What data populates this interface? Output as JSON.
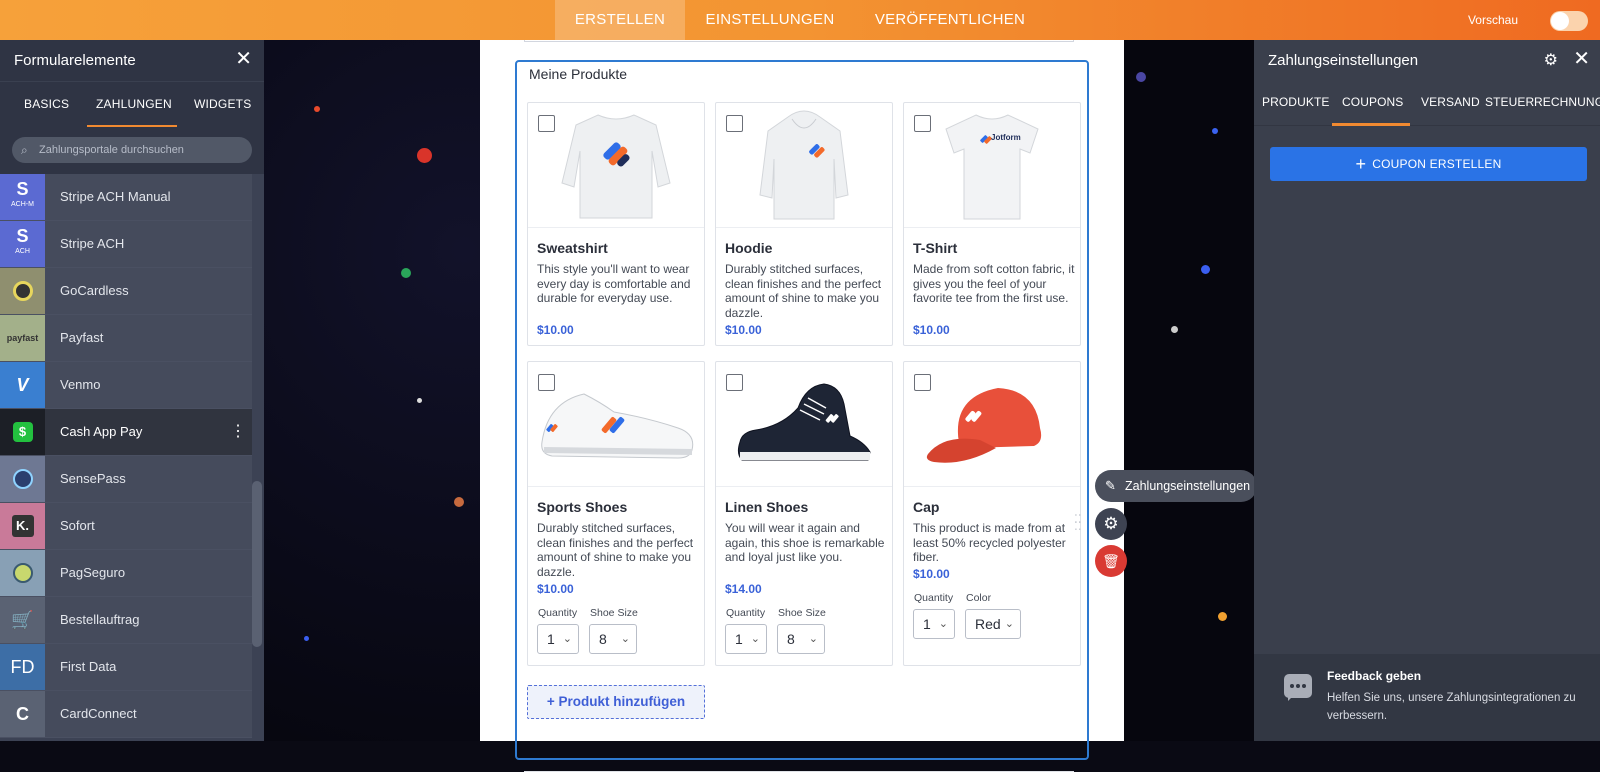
{
  "topbar": {
    "tabs": [
      "ERSTELLEN",
      "EINSTELLUNGEN",
      "VERÖFFENTLICHEN"
    ],
    "preview_label": "Vorschau"
  },
  "left_panel": {
    "title": "Formularelemente",
    "tabs": [
      "BASICS",
      "ZAHLUNGEN",
      "WIDGETS"
    ],
    "active_tab": "ZAHLUNGEN",
    "search_placeholder": "Zahlungsportale durchsuchen",
    "items": [
      {
        "name": "Stripe ACH Manual",
        "icon": "S",
        "sub": "ACH-M",
        "color": "#5b6ad2"
      },
      {
        "name": "Stripe ACH",
        "icon": "S",
        "sub": "ACH",
        "color": "#5b6ad2"
      },
      {
        "name": "GoCardless",
        "icon": "gocardless-icon",
        "color": "#8f8f6f"
      },
      {
        "name": "Payfast",
        "icon": "payfast",
        "color": "#a3b08a"
      },
      {
        "name": "Venmo",
        "icon": "V",
        "color": "#3a7fd0"
      },
      {
        "name": "Cash App Pay",
        "icon": "$",
        "color": "#1c1f26"
      },
      {
        "name": "SensePass",
        "icon": "sensepass-icon",
        "color": "#6e7893"
      },
      {
        "name": "Sofort",
        "icon": "K.",
        "color": "#c97a99"
      },
      {
        "name": "PagSeguro",
        "icon": "pagseguro-icon",
        "color": "#88a0b5"
      },
      {
        "name": "Bestellauftrag",
        "icon": "cart-icon",
        "color": "#5a6273"
      },
      {
        "name": "First Data",
        "icon": "FD",
        "color": "#3d6ea6"
      },
      {
        "name": "CardConnect",
        "icon": "C",
        "color": "#5a6273"
      }
    ]
  },
  "form": {
    "section_title": "Meine Produkte",
    "add_product_label": "+ Produkt hinzufügen",
    "products": [
      {
        "name": "Sweatshirt",
        "desc": "This style you'll want to wear every day is comfortable and durable for everyday use.",
        "price": "$10.00"
      },
      {
        "name": "Hoodie",
        "desc": "Durably stitched surfaces, clean finishes and the perfect amount of shine to make you dazzle.",
        "price": "$10.00"
      },
      {
        "name": "T-Shirt",
        "desc": "Made from soft cotton fabric, it gives you the feel of your favorite tee from the first use.",
        "price": "$10.00",
        "brand": "Jotform"
      },
      {
        "name": "Sports Shoes",
        "desc": "Durably stitched surfaces, clean finishes and the perfect amount of shine to make you dazzle.",
        "price": "$10.00",
        "qty_label": "Quantity",
        "opt_label": "Shoe Size",
        "qty": "1",
        "opt": "8"
      },
      {
        "name": "Linen Shoes",
        "desc": "You will wear it again and again, this shoe is remarkable and loyal just like you.",
        "price": "$14.00",
        "qty_label": "Quantity",
        "opt_label": "Shoe Size",
        "qty": "1",
        "opt": "8"
      },
      {
        "name": "Cap",
        "desc": "This product is made from at least 50% recycled polyester fiber.",
        "price": "$10.00",
        "qty_label": "Quantity",
        "opt_label": "Color",
        "qty": "1",
        "opt": "Red"
      }
    ]
  },
  "floating": {
    "pay_settings_label": "Zahlungseinstellungen"
  },
  "right_panel": {
    "title": "Zahlungseinstellungen",
    "tabs": [
      "PRODUKTE",
      "COUPONS",
      "VERSAND",
      "STEUER",
      "RECHNUNG"
    ],
    "active_tab": "COUPONS",
    "create_coupon_label": "COUPON ERSTELLEN",
    "feedback_title": "Feedback geben",
    "feedback_text": "Helfen Sie uns, unsere Zahlungsintegrationen zu verbessern."
  },
  "colors": {
    "accent_orange": "#f18a31",
    "primary_blue": "#2a73e6",
    "price_blue": "#3a62d8",
    "delete_red": "#d93a33"
  }
}
